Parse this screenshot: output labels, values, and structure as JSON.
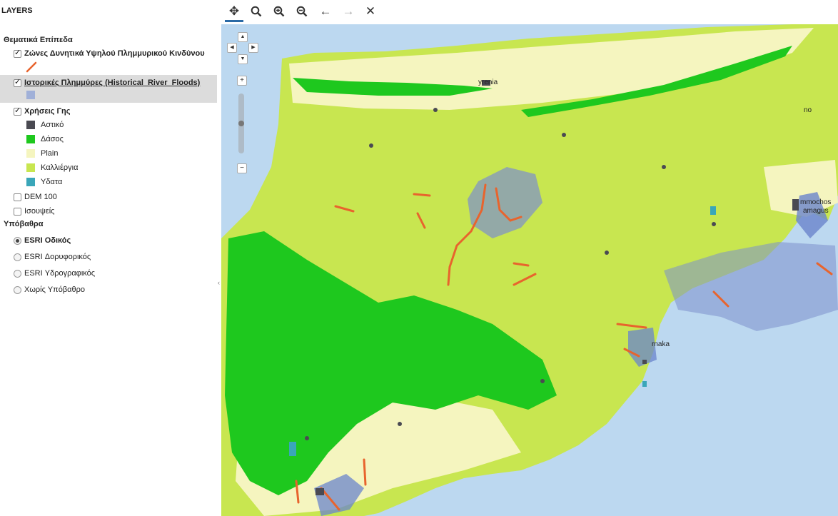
{
  "panel": {
    "title": "LAYERS",
    "thematic_group": "Θεματικά Επίπεδα",
    "layers": [
      {
        "label": "Ζώνες Δυνητικά Υψηλού Πλημμυρικού Κινδύνου",
        "checked": true
      },
      {
        "label": "Ιστορικές Πλημμύρες (Historical_River_Floods)",
        "checked": true
      },
      {
        "label": "Χρήσεις Γης",
        "checked": true
      },
      {
        "label": "DEM 100",
        "checked": false
      },
      {
        "label": "Ισουψείς",
        "checked": false
      }
    ],
    "landuse_legend": [
      {
        "label": "Αστικό",
        "color": "#4a4a52"
      },
      {
        "label": "Δάσος",
        "color": "#1ec81e"
      },
      {
        "label": "Plain",
        "color": "#f5f5bf"
      },
      {
        "label": "Καλλιέργια",
        "color": "#c8e650"
      },
      {
        "label": "Υδατα",
        "color": "#3aa6b9"
      }
    ],
    "flood_zone_color": "#e8642d",
    "historical_flood_color": "#a0b0d8",
    "basemap_group": "Υπόβαθρα",
    "basemaps": [
      {
        "label": "ESRI Οδικός",
        "selected": true
      },
      {
        "label": "ESRI Δορυφορικός",
        "selected": false
      },
      {
        "label": "ESRI Υδρογραφικός",
        "selected": false
      },
      {
        "label": "Χωρίς Υπόβαθρο",
        "selected": false
      }
    ]
  },
  "toolbar": {
    "tools": [
      {
        "name": "pan-tool",
        "glyph": "✥"
      },
      {
        "name": "zoom-tool",
        "glyph": "🔍︎"
      },
      {
        "name": "zoom-in-tool",
        "glyph": "⊕"
      },
      {
        "name": "zoom-out-tool",
        "glyph": "⊖"
      },
      {
        "name": "back-tool",
        "glyph": "←"
      },
      {
        "name": "forward-tool",
        "glyph": "→"
      },
      {
        "name": "full-extent-tool",
        "glyph": "⤢"
      }
    ]
  },
  "map": {
    "places": [
      "Kyrenia",
      "Ammochostos",
      "Famagusta",
      "Larnaka"
    ],
    "place_fragments": [
      "yrenia",
      "mmochos",
      "amagus",
      "rnaka",
      "no"
    ],
    "sea_color": "#bcd8f0",
    "land_color": "#c8e650"
  }
}
